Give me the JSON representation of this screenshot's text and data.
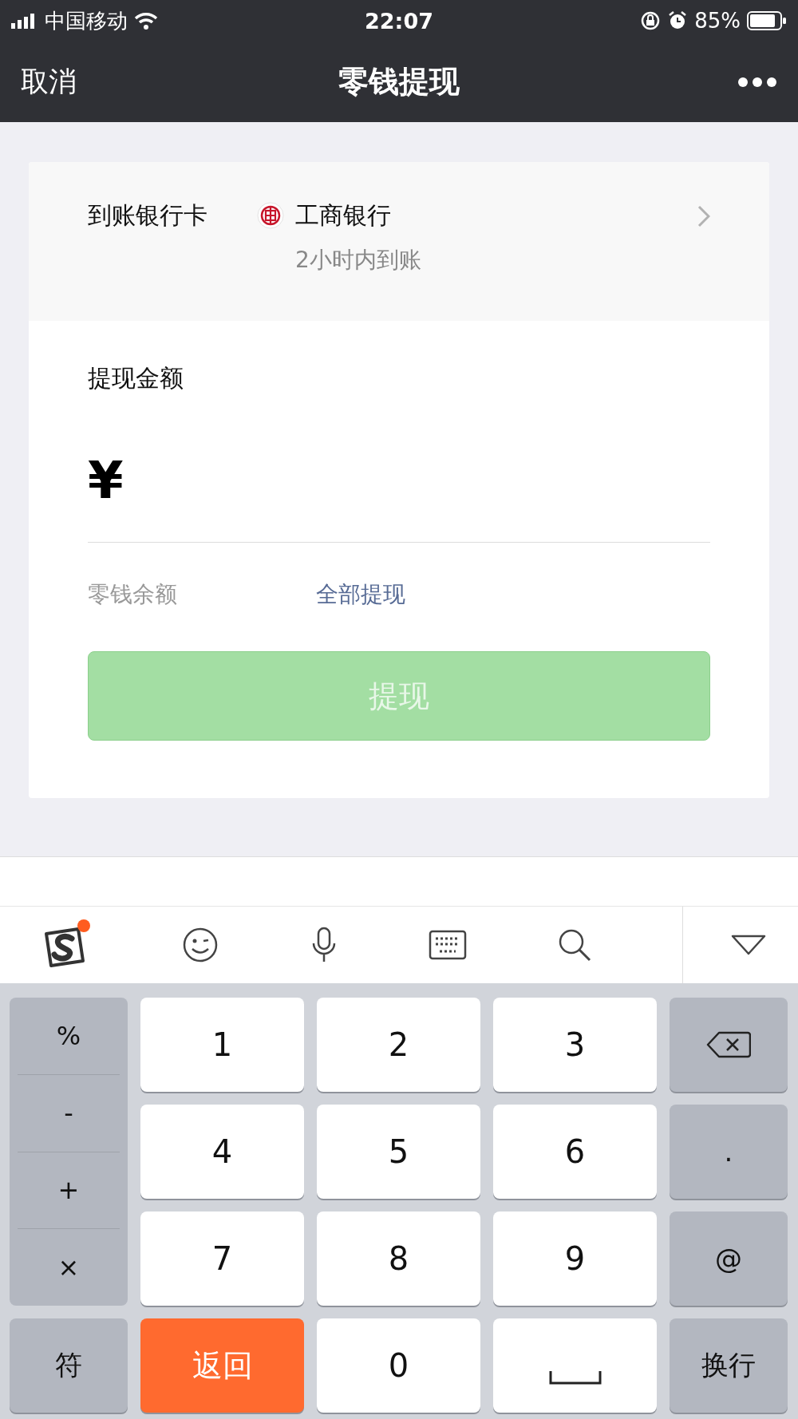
{
  "status_bar": {
    "carrier": "中国移动",
    "time": "22:07",
    "battery": "85%"
  },
  "nav": {
    "back": "取消",
    "title": "零钱提现"
  },
  "bank": {
    "label": "到账银行卡",
    "name": "工商银行",
    "eta": "2小时内到账"
  },
  "amount": {
    "label": "提现金额",
    "currency": "¥"
  },
  "balance": {
    "label": "零钱余额",
    "link": "全部提现"
  },
  "withdraw_button": {
    "label": "提现",
    "disabled": true
  },
  "keyboard": {
    "symbols": [
      "%",
      "-",
      "+",
      "×"
    ],
    "keys": [
      {
        "kind": "digit",
        "label": "1"
      },
      {
        "kind": "digit",
        "label": "2"
      },
      {
        "kind": "digit",
        "label": "3"
      },
      {
        "kind": "backspace"
      },
      {
        "kind": "digit",
        "label": "4"
      },
      {
        "kind": "digit",
        "label": "5"
      },
      {
        "kind": "digit",
        "label": "6"
      },
      {
        "kind": "function",
        "label": "."
      },
      {
        "kind": "digit",
        "label": "7"
      },
      {
        "kind": "digit",
        "label": "8"
      },
      {
        "kind": "digit",
        "label": "9"
      },
      {
        "kind": "function",
        "label": "@"
      },
      {
        "kind": "function",
        "label": "符"
      },
      {
        "kind": "accent",
        "label": "返回"
      },
      {
        "kind": "digit",
        "label": "0"
      },
      {
        "kind": "space"
      },
      {
        "kind": "function",
        "label": "换行"
      }
    ]
  }
}
